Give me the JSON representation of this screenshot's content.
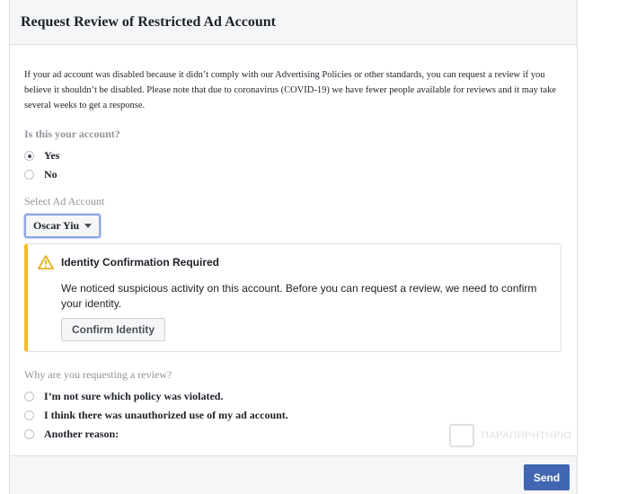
{
  "header": {
    "title": "Request Review of Restricted Ad Account"
  },
  "intro": "If your ad account was disabled because it didn’t comply with our Advertising Policies or other standards, you can request a review if you believe it shouldn’t be disabled. Please note that due to coronavirus (COVID-19) we have fewer people available for reviews and it may take several weeks to get a response.",
  "ownership": {
    "question": "Is this your account?",
    "options": [
      {
        "label": "Yes",
        "selected": true
      },
      {
        "label": "No",
        "selected": false
      }
    ]
  },
  "ad_account": {
    "label": "Select Ad Account",
    "selected": "Oscar Yiu"
  },
  "warning": {
    "icon": "warning-triangle-icon",
    "title": "Identity Confirmation Required",
    "text": "We noticed suspicious activity on this account. Before you can request a review, we need to confirm your identity.",
    "button": "Confirm Identity",
    "accent_color": "#f7b928"
  },
  "reason": {
    "question": "Why are you requesting a review?",
    "options": [
      {
        "label": "I’m not sure which policy was violated.",
        "selected": false
      },
      {
        "label": "I think there was unauthorized use of my ad account.",
        "selected": false
      },
      {
        "label": "Another reason:",
        "selected": false
      }
    ]
  },
  "footer": {
    "send_label": "Send",
    "send_color": "#4267b2"
  },
  "watermark": {
    "text": "ΠΑΡΑΠΗΡΗΤΗΡΙΟ"
  }
}
